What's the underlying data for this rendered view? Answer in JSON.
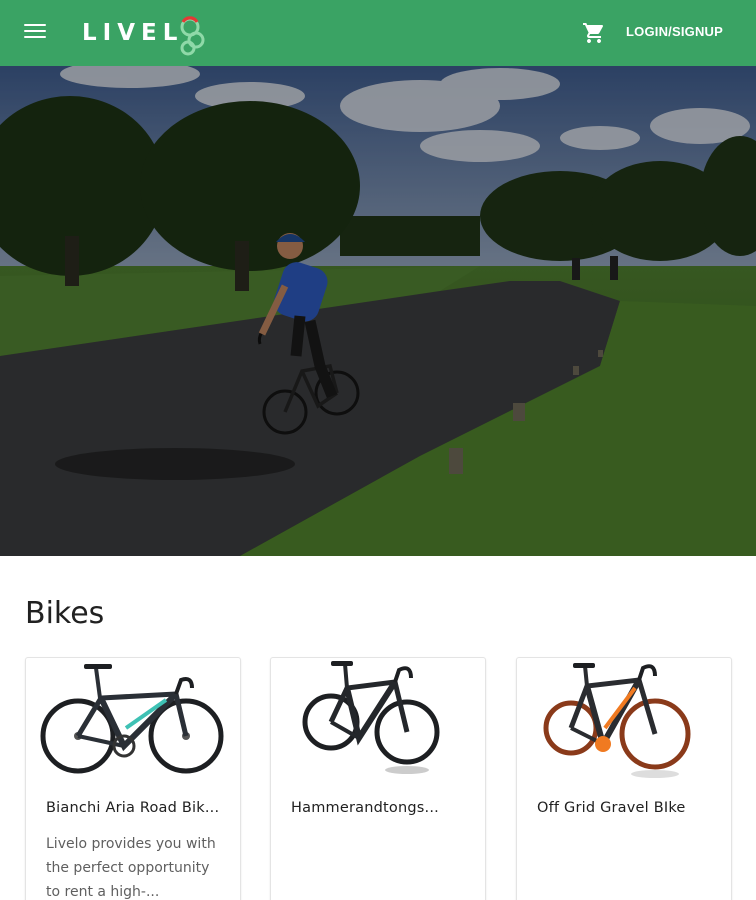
{
  "header": {
    "brand": "LIVEL",
    "login_label": "LOGIN/SIGNUP",
    "colors": {
      "bar": "#3aa364",
      "logo_ring_red": "#e53935",
      "logo_ring_green": "#8fd9a8"
    }
  },
  "hero": {
    "alt": "cyclist on a park road"
  },
  "bikes_section": {
    "title": "Bikes",
    "cards": [
      {
        "title": "Bianchi Aria Road Bik...",
        "description": "Livelo provides you with the perfect opportunity to rent a high-...",
        "frame_color": "#2a2f36",
        "accent_color": "#3ec1b4"
      },
      {
        "title": "Hammerandtongs...",
        "description": "",
        "frame_color": "#24272b",
        "accent_color": "#3b3f44"
      },
      {
        "title": "Off Grid Gravel BIke",
        "description": "",
        "frame_color": "#2a2c30",
        "accent_color": "#f07a21"
      }
    ]
  }
}
